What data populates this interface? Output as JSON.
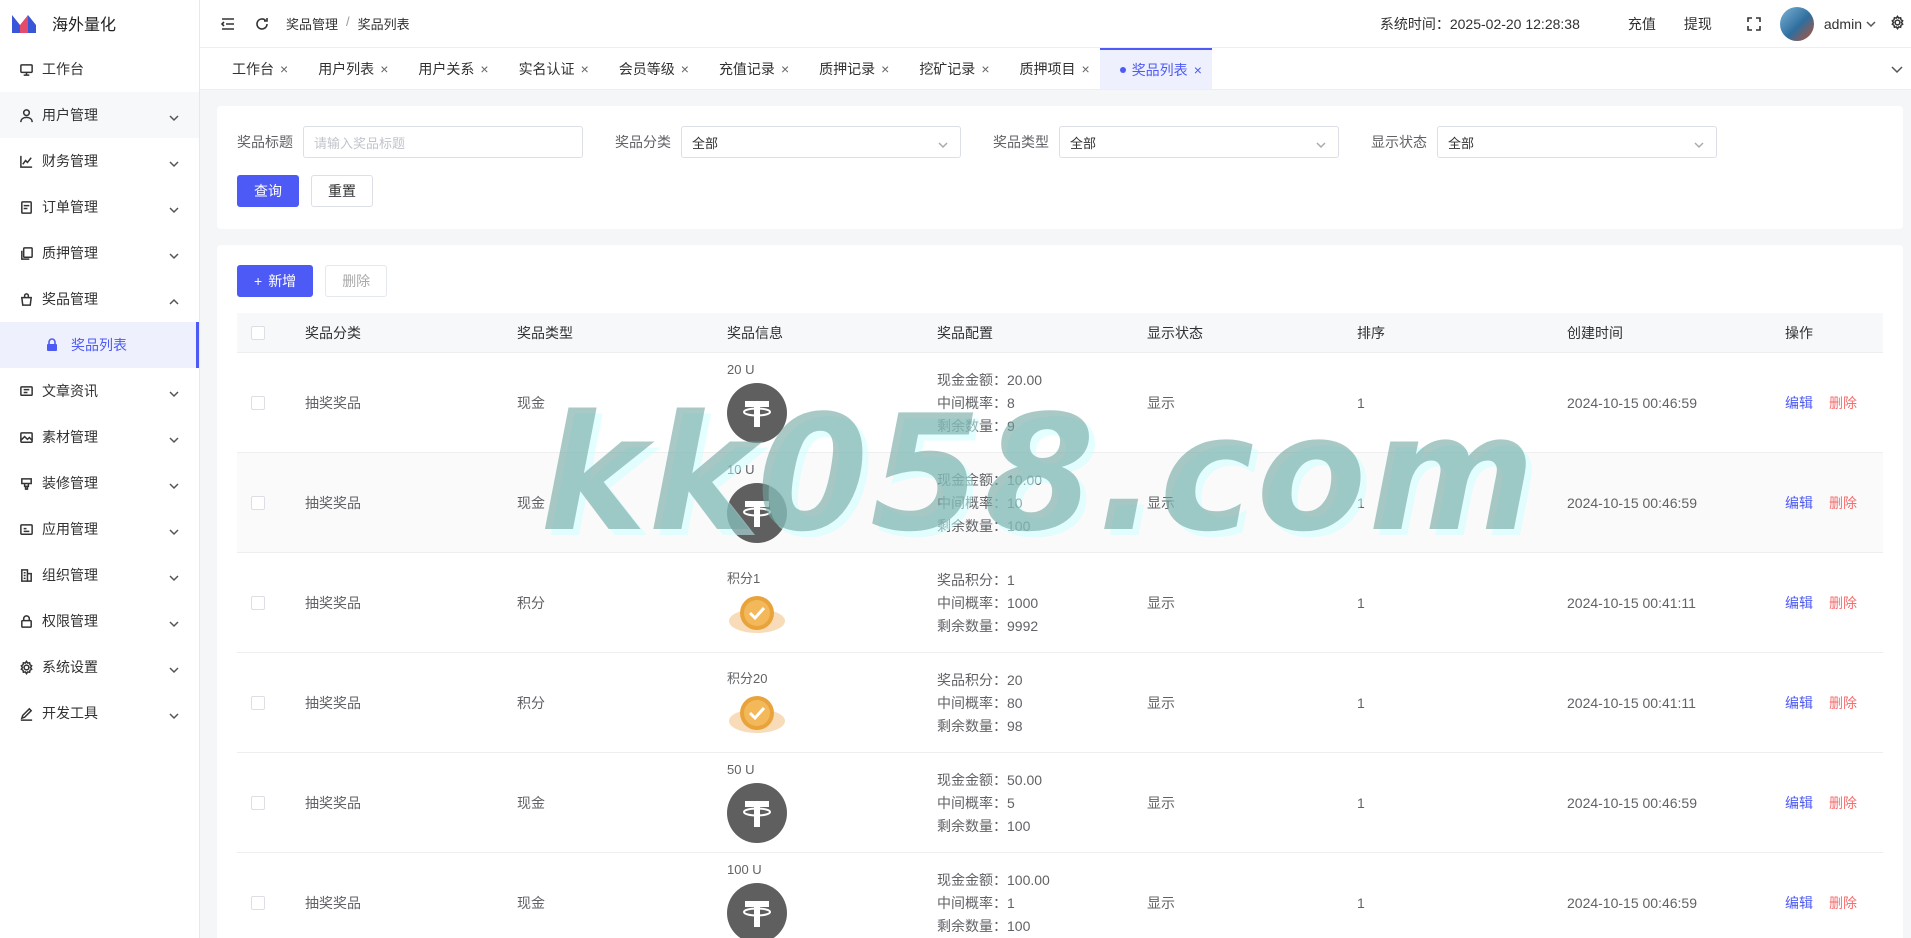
{
  "app": {
    "title": "海外量化"
  },
  "sidebar": {
    "items": [
      {
        "label": "工作台",
        "icon": "monitor-icon"
      },
      {
        "label": "用户管理",
        "icon": "user-icon"
      },
      {
        "label": "财务管理",
        "icon": "chart-icon"
      },
      {
        "label": "订单管理",
        "icon": "order-icon"
      },
      {
        "label": "质押管理",
        "icon": "copy-icon"
      },
      {
        "label": "奖品管理",
        "icon": "bag-icon"
      },
      {
        "label": "文章资讯",
        "icon": "message-icon"
      },
      {
        "label": "素材管理",
        "icon": "image-icon"
      },
      {
        "label": "装修管理",
        "icon": "brush-icon"
      },
      {
        "label": "应用管理",
        "icon": "app-icon"
      },
      {
        "label": "组织管理",
        "icon": "org-icon"
      },
      {
        "label": "权限管理",
        "icon": "lock-icon"
      },
      {
        "label": "系统设置",
        "icon": "gear-icon"
      },
      {
        "label": "开发工具",
        "icon": "pen-icon"
      }
    ],
    "sub_active": "奖品列表"
  },
  "header": {
    "breadcrumb": [
      "奖品管理",
      "奖品列表"
    ],
    "breadcrumb_sep": "/",
    "system_time": "系统时间：2025-02-20 12:28:38",
    "recharge": "充值",
    "withdraw": "提现",
    "user": "admin"
  },
  "tabs": [
    {
      "label": "工作台"
    },
    {
      "label": "用户列表"
    },
    {
      "label": "用户关系"
    },
    {
      "label": "实名认证"
    },
    {
      "label": "会员等级"
    },
    {
      "label": "充值记录"
    },
    {
      "label": "质押记录"
    },
    {
      "label": "挖矿记录"
    },
    {
      "label": "质押项目"
    },
    {
      "label": "奖品列表",
      "active": true
    }
  ],
  "tab_close": "×",
  "filters": {
    "title_label": "奖品标题",
    "title_placeholder": "请输入奖品标题",
    "category_label": "奖品分类",
    "category_value": "全部",
    "type_label": "奖品类型",
    "type_value": "全部",
    "status_label": "显示状态",
    "status_value": "全部",
    "query": "查询",
    "reset": "重置"
  },
  "toolbar": {
    "add": "新增",
    "add_plus": "+",
    "delete": "删除"
  },
  "table": {
    "columns": [
      "奖品分类",
      "奖品类型",
      "奖品信息",
      "奖品配置",
      "显示状态",
      "排序",
      "创建时间",
      "操作"
    ],
    "edit": "编辑",
    "remove": "删除",
    "rows": [
      {
        "category": "抽奖奖品",
        "type": "现金",
        "info": "20 U",
        "img": "usdt",
        "cfg": [
          "现金金额：20.00",
          "中间概率：8",
          "剩余数量：9"
        ],
        "status": "显示",
        "sort": "1",
        "created": "2024-10-15 00:46:59"
      },
      {
        "category": "抽奖奖品",
        "type": "现金",
        "info": "10 U",
        "img": "usdt",
        "cfg": [
          "现金金额：10.00",
          "中间概率：10",
          "剩余数量：100"
        ],
        "status": "显示",
        "sort": "1",
        "created": "2024-10-15 00:46:59"
      },
      {
        "category": "抽奖奖品",
        "type": "积分",
        "info": "积分1",
        "img": "coin",
        "cfg": [
          "奖品积分：1",
          "中间概率：1000",
          "剩余数量：9992"
        ],
        "status": "显示",
        "sort": "1",
        "created": "2024-10-15 00:41:11"
      },
      {
        "category": "抽奖奖品",
        "type": "积分",
        "info": "积分20",
        "img": "coin",
        "cfg": [
          "奖品积分：20",
          "中间概率：80",
          "剩余数量：98"
        ],
        "status": "显示",
        "sort": "1",
        "created": "2024-10-15 00:41:11"
      },
      {
        "category": "抽奖奖品",
        "type": "现金",
        "info": "50 U",
        "img": "usdt",
        "cfg": [
          "现金金额：50.00",
          "中间概率：5",
          "剩余数量：100"
        ],
        "status": "显示",
        "sort": "1",
        "created": "2024-10-15 00:46:59"
      },
      {
        "category": "抽奖奖品",
        "type": "现金",
        "info": "100 U",
        "img": "usdt",
        "cfg": [
          "现金金额：100.00",
          "中间概率：1",
          "剩余数量：100"
        ],
        "status": "显示",
        "sort": "1",
        "created": "2024-10-15 00:46:59"
      }
    ]
  },
  "watermark": "kk058.com",
  "colors": {
    "primary": "#4d5af5",
    "danger": "#f56c6c",
    "usdt_bg": "#5f5f5f",
    "coin": "#e8a33b"
  }
}
